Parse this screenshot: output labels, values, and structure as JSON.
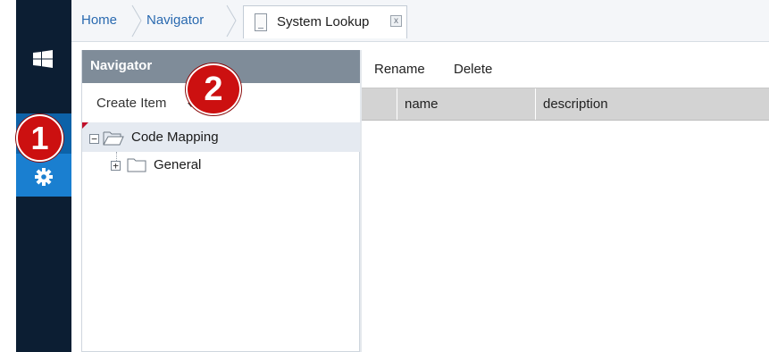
{
  "breadcrumb": {
    "home": "Home",
    "navigator": "Navigator"
  },
  "tab": {
    "label": "System Lookup",
    "close_symbol": "x"
  },
  "navigator": {
    "title": "Navigator",
    "create_item": "Create Item",
    "tree": [
      {
        "label": "Code Mapping",
        "expand": "−",
        "selected": true
      },
      {
        "label": "General",
        "expand": "+",
        "selected": false
      }
    ]
  },
  "toolbar": {
    "rename": "Rename",
    "delete": "Delete"
  },
  "grid": {
    "columns": [
      "name",
      "description"
    ]
  },
  "callouts": {
    "one": "1",
    "two": "2"
  },
  "icons": {
    "rail_top": "windows-icon",
    "rail_selected": "gear-icon",
    "tab": "document-icon",
    "tree_folder": "folder-icon"
  },
  "colors": {
    "rail": "#0c1e33",
    "rail_selected": "#1a7fd0",
    "nav_header": "#7f8c99",
    "selected_row": "#e5eaf1",
    "callout": "#cc1010",
    "link": "#2a6ab0"
  }
}
